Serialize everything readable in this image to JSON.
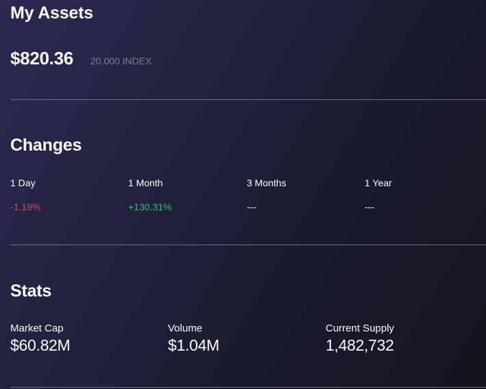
{
  "assets": {
    "title": "My Assets",
    "balance": "$820.36",
    "units": "20.000 INDEX"
  },
  "changes": {
    "title": "Changes",
    "items": [
      {
        "label": "1 Day",
        "value": "-1.19%",
        "trend": "negative"
      },
      {
        "label": "1 Month",
        "value": "+130.31%",
        "trend": "positive"
      },
      {
        "label": "3 Months",
        "value": "---",
        "trend": "neutral"
      },
      {
        "label": "1 Year",
        "value": "---",
        "trend": "neutral"
      }
    ]
  },
  "stats": {
    "title": "Stats",
    "items": [
      {
        "label": "Market Cap",
        "value": "$60.82M"
      },
      {
        "label": "Volume",
        "value": "$1.04M"
      },
      {
        "label": "Current Supply",
        "value": "1,482,732"
      }
    ]
  },
  "colors": {
    "negative": "#e0435a",
    "positive": "#2fc46a",
    "muted": "#7c7c92"
  }
}
